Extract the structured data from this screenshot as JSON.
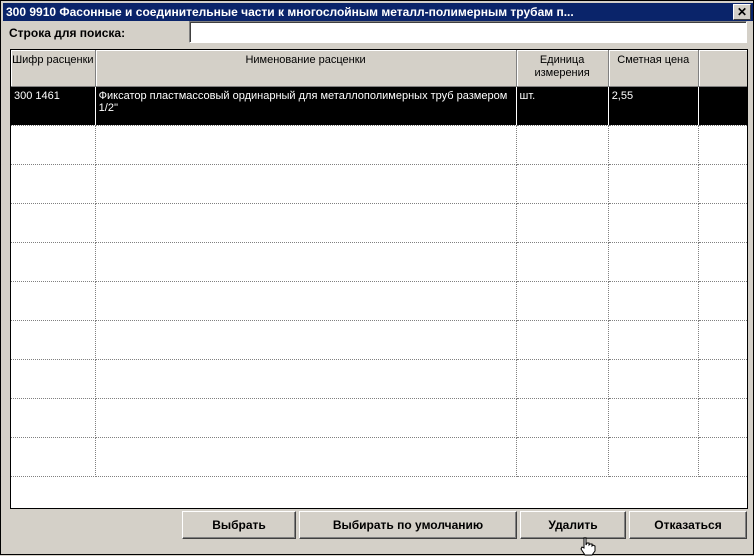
{
  "window": {
    "title": "300 9910 Фасонные и соединительные части к многослойным металл-полимерным трубам п...",
    "close_label": "✕"
  },
  "search": {
    "label": "Строка для поиска:",
    "value": ""
  },
  "grid": {
    "columns": [
      {
        "label": "Шифр расценки"
      },
      {
        "label": "Нименование расценки"
      },
      {
        "label": "Единица измерения"
      },
      {
        "label": "Сметная цена"
      },
      {
        "label": ""
      }
    ],
    "rows": [
      {
        "code": "300 1461",
        "name": "Фиксатор пластмассовый ординарный для металлополимерных труб размером 1/2''",
        "unit": "шт.",
        "price": "2,55"
      }
    ]
  },
  "buttons": {
    "select": "Выбрать",
    "select_default": "Выбирать по умолчанию",
    "delete": "Удалить",
    "cancel": "Отказаться"
  }
}
